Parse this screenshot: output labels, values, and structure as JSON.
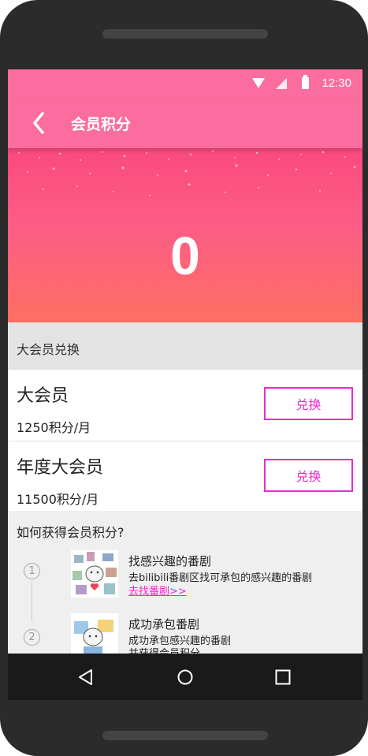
{
  "status_bar": {
    "time": "12:30"
  },
  "app_bar": {
    "title": "会员积分",
    "back_icon": "back-arrow-icon"
  },
  "hero": {
    "points": "0"
  },
  "exchange_section": {
    "header": "大会员兑换",
    "items": [
      {
        "title": "大会员",
        "price": "1250积分/月",
        "button": "兑换"
      },
      {
        "title": "年度大会员",
        "price": "11500积分/月",
        "button": "兑换"
      }
    ]
  },
  "how_to": {
    "title": "如何获得会员积分?",
    "steps": [
      {
        "number": "1",
        "title": "找感兴趣的番剧",
        "desc": "去bilibili番剧区找可承包的感兴趣的番剧",
        "link": "去找番剧>>"
      },
      {
        "number": "2",
        "title": "成功承包番剧",
        "desc": "成功承包感兴趣的番剧",
        "desc2": "并获得会员积分"
      }
    ]
  },
  "colors": {
    "accent": "#fb6d9e",
    "button": "#e92bd0"
  }
}
